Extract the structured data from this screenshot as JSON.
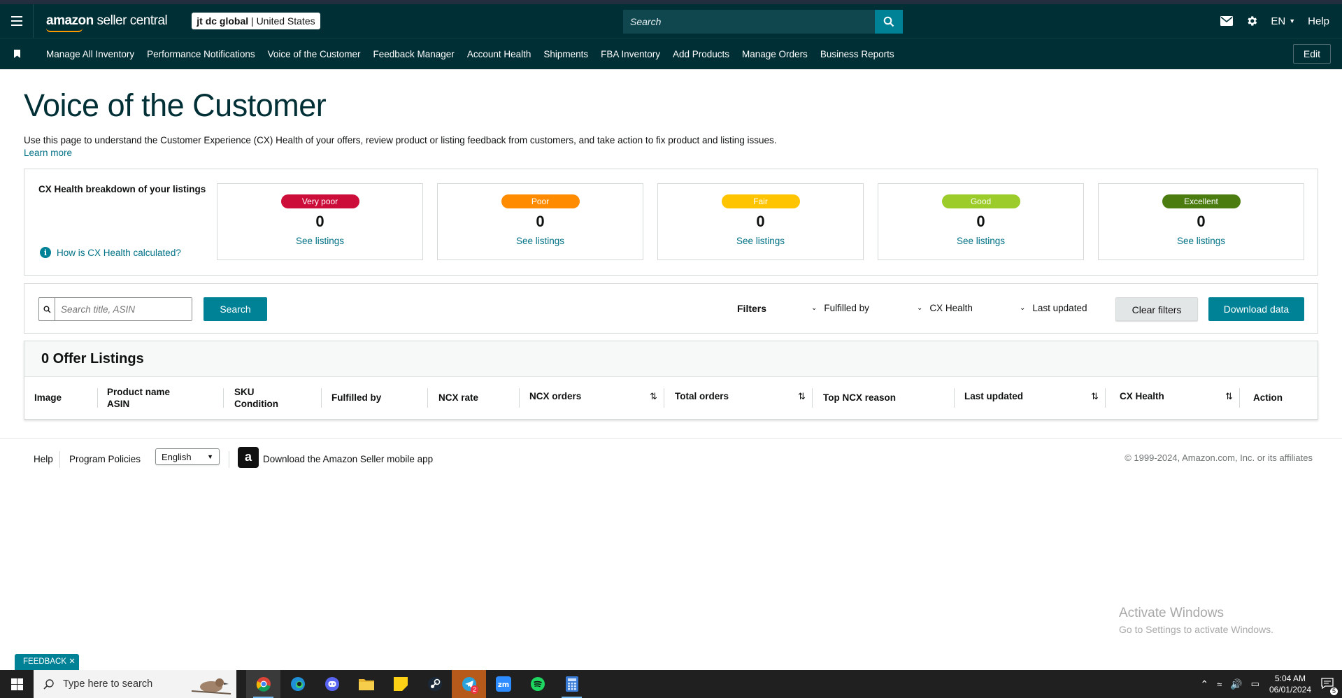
{
  "header": {
    "logo_bold": "amazon",
    "logo_light": " seller central",
    "account_name": "jt dc global",
    "account_region": "United States",
    "search_placeholder": "Search",
    "language": "EN",
    "help": "Help"
  },
  "nav": {
    "items": [
      "Manage All Inventory",
      "Performance Notifications",
      "Voice of the Customer",
      "Feedback Manager",
      "Account Health",
      "Shipments",
      "FBA Inventory",
      "Add Products",
      "Manage Orders",
      "Business Reports"
    ],
    "edit": "Edit"
  },
  "page": {
    "title": "Voice of the Customer",
    "description": "Use this page to understand the Customer Experience (CX) Health of your offers, review product or listing feedback from customers, and take action to fix product and listing issues.",
    "learn_more": "Learn more"
  },
  "health": {
    "title": "CX Health breakdown of your listings",
    "how_link": "How is CX Health calculated?",
    "cards": [
      {
        "label": "Very poor",
        "count": "0",
        "link": "See listings",
        "color": "#cc0c39"
      },
      {
        "label": "Poor",
        "count": "0",
        "link": "See listings",
        "color": "#ff8c00"
      },
      {
        "label": "Fair",
        "count": "0",
        "link": "See listings",
        "color": "#ffc400"
      },
      {
        "label": "Good",
        "count": "0",
        "link": "See listings",
        "color": "#9ccc2a"
      },
      {
        "label": "Excellent",
        "count": "0",
        "link": "See listings",
        "color": "#4b7c0f"
      }
    ]
  },
  "filters": {
    "search_placeholder": "Search title, ASIN",
    "search_button": "Search",
    "label": "Filters",
    "fulfilled_by": "Fulfilled by",
    "cx_health": "CX Health",
    "last_updated": "Last updated",
    "clear": "Clear filters",
    "download": "Download data"
  },
  "listings": {
    "heading": "0 Offer Listings",
    "columns": {
      "image": "Image",
      "product_name": "Product name",
      "asin": "ASIN",
      "sku": "SKU",
      "condition": "Condition",
      "fulfilled_by": "Fulfilled by",
      "ncx_rate": "NCX rate",
      "ncx_orders": "NCX orders",
      "total_orders": "Total orders",
      "top_ncx_reason": "Top NCX reason",
      "last_updated": "Last updated",
      "cx_health": "CX Health",
      "action": "Action"
    }
  },
  "footer": {
    "help": "Help",
    "policies": "Program Policies",
    "language": "English",
    "app_text": "Download the Amazon Seller mobile app",
    "copyright": "© 1999-2024, Amazon.com, Inc. or its affiliates"
  },
  "windows": {
    "activate_title": "Activate Windows",
    "activate_sub": "Go to Settings to activate Windows.",
    "feedback": "FEEDBACK",
    "taskbar_search": "Type here to search",
    "time": "5:04 AM",
    "date": "06/01/2024",
    "notifications": "5",
    "telegram_badge": "2"
  }
}
